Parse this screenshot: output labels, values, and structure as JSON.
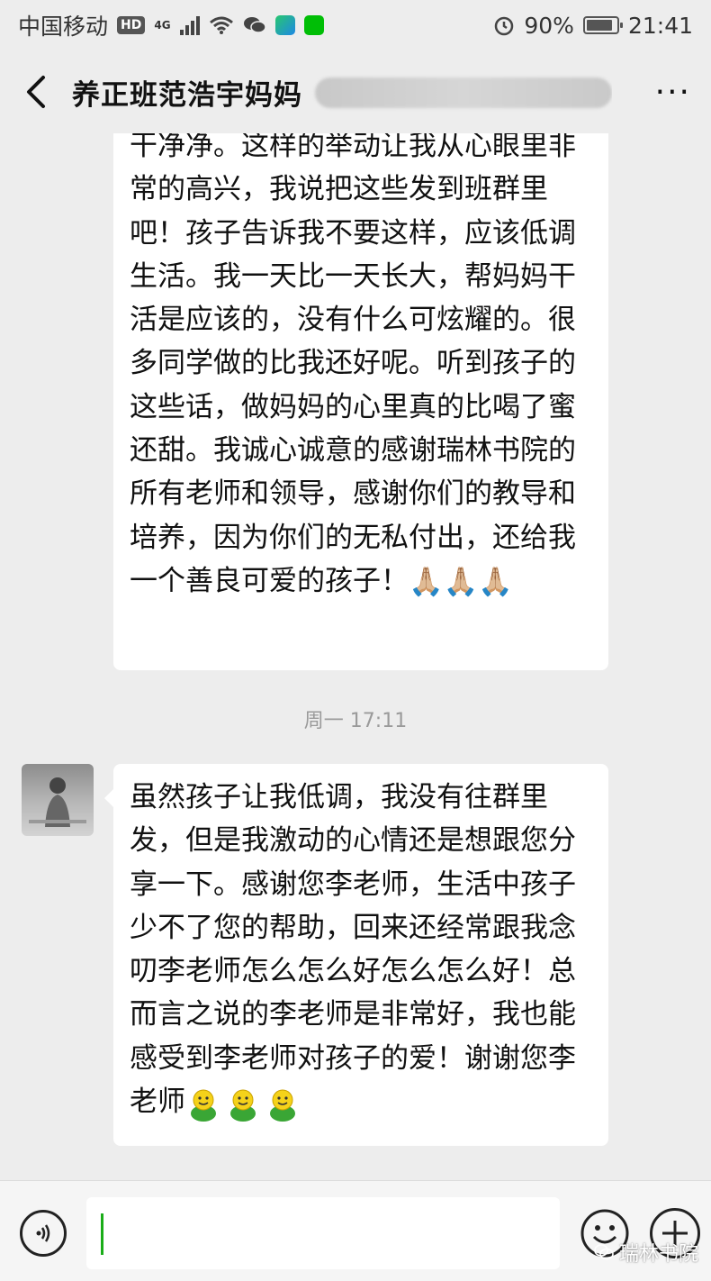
{
  "status_bar": {
    "carrier": "中国移动",
    "hd_badge": "HD",
    "network": "4G",
    "battery": "90%",
    "time": "21:41"
  },
  "nav": {
    "title": "养正班范浩宇妈妈",
    "back_icon": "chevron-left-icon",
    "more_icon": "more-dots-icon"
  },
  "messages": [
    {
      "text": "干净净。这样的举动让我从心眼里非常的高兴，我说把这些发到班群里吧！孩子告诉我不要这样，应该低调生活。我一天比一天长大，帮妈妈干活是应该的，没有什么可炫耀的。很多同学做的比我还好呢。听到孩子的这些话，做妈妈的心里真的比喝了蜜还甜。我诚心诚意的感谢瑞林书院的所有老师和领导，感谢你们的教导和培养，因为你们的无私付出，还给我一个善良可爱的孩子！",
      "emoji": "🙏🏼🙏🏼🙏🏼"
    },
    {
      "text": "虽然孩子让我低调，我没有往群里发，但是我激动的心情还是想跟您分享一下。感谢您李老师，生活中孩子少不了您的帮助，回来还经常跟我念叨李老师怎么怎么好怎么怎么好！总而言之说的李老师是非常好，我也能感受到李老师对孩子的爱！谢谢您李老师"
    }
  ],
  "timestamp": "周一 17:11",
  "input": {
    "value": "",
    "voice_icon": "voice-icon",
    "emoji_icon": "emoji-icon",
    "plus_icon": "plus-icon"
  },
  "watermark": "瑞林书院",
  "colors": {
    "background": "#ededed",
    "bubble": "#ffffff",
    "cursor": "#1aad19"
  }
}
